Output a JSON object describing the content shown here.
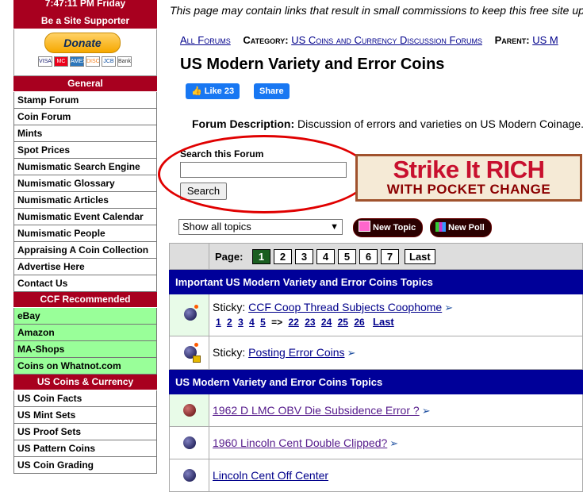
{
  "sidebar": {
    "time": "7:47:11 PM Friday",
    "supporter_header": "Be a Site Supporter",
    "donate_label": "Donate",
    "cards": [
      "VISA",
      "MC",
      "AMEX",
      "DISC",
      "JCB",
      "Bank"
    ],
    "general_header": "General",
    "general_items": [
      "Stamp Forum",
      "Coin Forum",
      "Mints",
      "Spot Prices",
      "Numismatic Search Engine",
      "Numismatic Glossary",
      "Numismatic Articles",
      "Numismatic Event Calendar",
      "Numismatic People",
      "Appraising A Coin Collection",
      "Advertise Here",
      "Contact Us"
    ],
    "recommended_header": "CCF Recommended",
    "recommended_items": [
      "eBay",
      "Amazon",
      "MA-Shops",
      "Coins on Whatnot.com"
    ],
    "us_header": "US Coins & Currency",
    "us_items": [
      "US Coin Facts",
      "US Mint Sets",
      "US Proof Sets",
      "US Pattern Coins",
      "US Coin Grading"
    ]
  },
  "page": {
    "note": "This page may contain links that result in small commissions to keep this free site up",
    "all_forums": "All Forums",
    "category_label": "Category:",
    "category_link": "US Coins and Currency Discussion Forums",
    "parent_label": "Parent:",
    "parent_link": "US M",
    "title": "US Modern Variety and Error Coins",
    "fb_like": "Like 23",
    "fb_share": "Share",
    "desc_label": "Forum Description:",
    "desc_text": " Discussion of errors and varieties on US Modern Coinage.",
    "search_label": "Search this Forum",
    "search_value": "",
    "search_button": "Search",
    "ad_line1": "Strike It RICH",
    "ad_line2": "WITH POCKET CHANGE",
    "topics_select": "Show all topics",
    "new_topic": "New Topic",
    "new_poll": "New Poll"
  },
  "table": {
    "page_label": "Page:",
    "pages": [
      "1",
      "2",
      "3",
      "4",
      "5",
      "6",
      "7",
      "Last"
    ],
    "important_header": "Important US Modern Variety and Error Coins Topics",
    "sticky_prefix": "Sticky:",
    "sticky1_title": "CCF Coop Thread Subjects Coophome",
    "sticky1_pages": [
      "1",
      "2",
      "3",
      "4",
      "5",
      "=>",
      "22",
      "23",
      "24",
      "25",
      "26",
      "Last"
    ],
    "sticky2_title": "Posting Error Coins",
    "topics_header": "US Modern Variety and Error Coins Topics",
    "topic1": "1962 D LMC OBV Die Subsidence Error ?",
    "topic2": "1960 Lincoln Cent Double Clipped?",
    "topic3": "Lincoln Cent Off Center"
  }
}
